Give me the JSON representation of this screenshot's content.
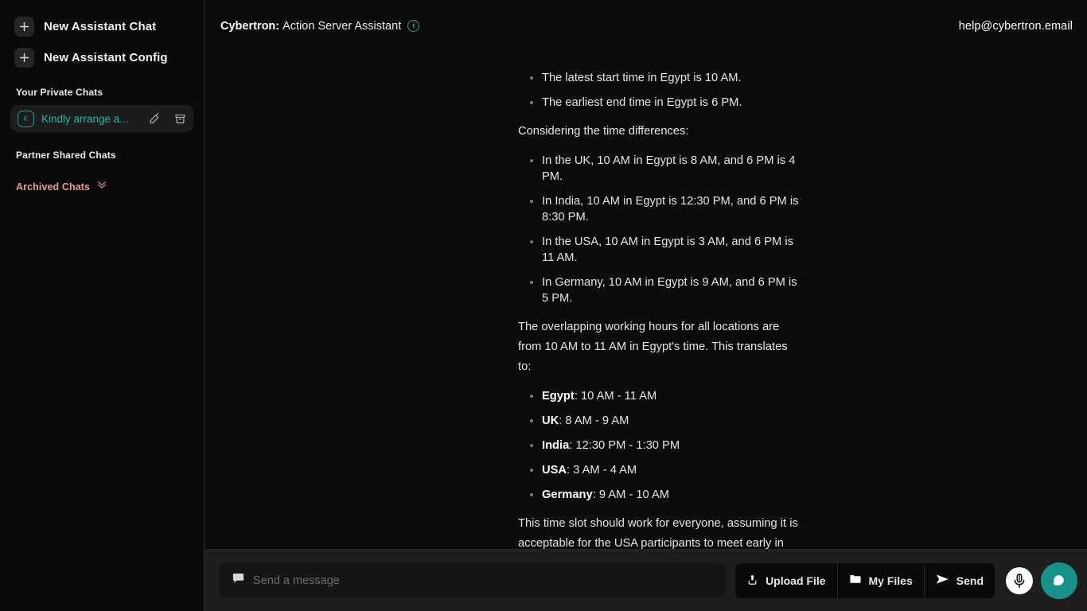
{
  "sidebar": {
    "new_chat_label": "New Assistant Chat",
    "new_config_label": "New Assistant Config",
    "private_section_label": "Your Private Chats",
    "partner_section_label": "Partner Shared Chats",
    "archived_label": "Archived Chats",
    "chats": [
      {
        "avatar_letter": "K",
        "title": "Kindly arrange a..."
      }
    ]
  },
  "header": {
    "title_strong": "Cybertron:",
    "title_rest": " Action Server Assistant",
    "info_glyph": "i",
    "account_email": "help@cybertron.email"
  },
  "message": {
    "top_bullets": [
      "The latest start time in Egypt is 10 AM.",
      "The earliest end time in Egypt is 6 PM."
    ],
    "para_considering": "Considering the time differences:",
    "diff_bullets": [
      "In the UK, 10 AM in Egypt is 8 AM, and 6 PM is 4 PM.",
      "In India, 10 AM in Egypt is 12:30 PM, and 6 PM is 8:30 PM.",
      "In the USA, 10 AM in Egypt is 3 AM, and 6 PM is 11 AM.",
      "In Germany, 10 AM in Egypt is 9 AM, and 6 PM is 5 PM."
    ],
    "para_overlap": "The overlapping working hours for all locations are from 10 AM to 11 AM in Egypt's time. This translates to:",
    "slot_bullets": [
      {
        "label": "Egypt",
        "value": ": 10 AM - 11 AM"
      },
      {
        "label": "UK",
        "value": ": 8 AM - 9 AM"
      },
      {
        "label": "India",
        "value": ": 12:30 PM - 1:30 PM"
      },
      {
        "label": "USA",
        "value": ": 3 AM - 4 AM"
      },
      {
        "label": "Germany",
        "value": ": 9 AM - 10 AM"
      }
    ],
    "para_closing": "This time slot should work for everyone, assuming it is acceptable for the USA participants to meet early in the morning."
  },
  "footer": {
    "input_placeholder": "Send a message",
    "upload_label": "Upload File",
    "myfiles_label": "My Files",
    "send_label": "Send"
  },
  "colors": {
    "accent_teal": "#179289",
    "accent_teal_text": "#1fb9a6",
    "archived_pink": "#e79a9a",
    "page_bg": "#0b0a0a",
    "footer_bg": "#201e1d"
  }
}
